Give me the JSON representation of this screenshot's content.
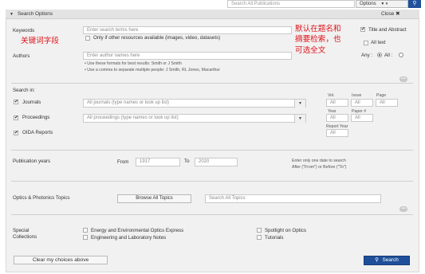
{
  "topbar": {
    "search_placeholder": "Search All Publications",
    "options_label": "Options",
    "options_icons": "▼ ▾",
    "go_icon": "⚲"
  },
  "header": {
    "icon": "▼",
    "title": "Search Options",
    "close_label": "Close ✖"
  },
  "keywords": {
    "label": "Keywords",
    "placeholder": "Enter search terms here",
    "only_resources_label": "Only if other resources available (images, video, datasets)",
    "title_abstract_label": "Title and Abstract",
    "all_text_label": "All text"
  },
  "authors": {
    "label": "Authors",
    "placeholder": "Enter author names here",
    "hint1": "• Use these formats for best results: Smith or J Smith",
    "hint2": "• Use a comma to separate multiple people: J Smith, RL Jones, Macarthur",
    "any_label": "Any :",
    "all_label": "All :"
  },
  "annotations": {
    "keywords_note": "关键词字段",
    "default_note_line1": "默认在题名和",
    "default_note_line2": "摘要检索，也",
    "default_note_line3": "可选全文"
  },
  "search_in": {
    "label": "Search in:",
    "journals_label": "Journals",
    "journals_placeholder": "All journals (type names or look up list)",
    "proceedings_label": "Proceedings",
    "proceedings_placeholder": "All proceedings (type names or look up list)",
    "oida_label": "OIDA Reports",
    "vol_label": "Vol.",
    "issue_label": "Issue",
    "page_label": "Page",
    "year_label": "Year",
    "paper_label": "Paper #",
    "report_year_label": "Report Year",
    "all_value": "All"
  },
  "pub_years": {
    "label": "Publication years",
    "from_label": "From",
    "from_value": "1917",
    "to_label": "To",
    "to_value": "2020",
    "hint1": "Enter only one date to search",
    "hint2": "After (\"From\") or Before (\"To\")"
  },
  "topics": {
    "label": "Optics & Photonics Topics",
    "browse_label": "Browse All Topics",
    "search_placeholder": "Search All Topics"
  },
  "special": {
    "label_line1": "Special",
    "label_line2": "Collections",
    "items": [
      "Energy and Environmental Optics Express",
      "Engineering and Laboratory Notes",
      "Spotlight on Optics",
      "Tutorials"
    ]
  },
  "footer": {
    "clear_label": "Clear my choices above",
    "search_label": "Search",
    "search_icon": "⚲"
  },
  "expand_icon": "•••"
}
